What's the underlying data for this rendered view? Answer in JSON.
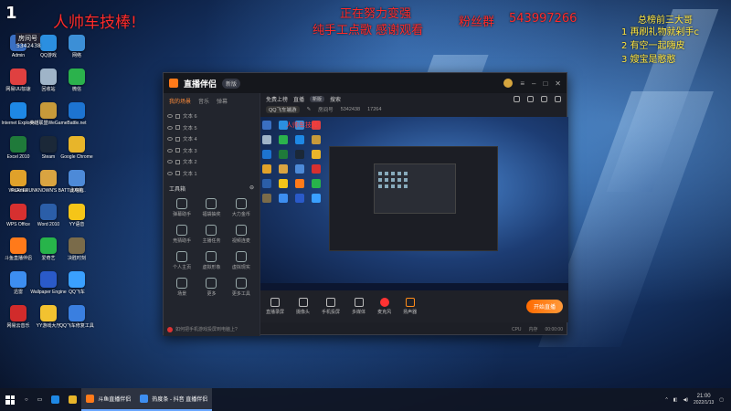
{
  "overlay": {
    "top_left_logo": "1",
    "title_red": "人帅车技棒!",
    "room_badge": "房间号",
    "room_number": "5342438",
    "center_line1": "正在努力变强",
    "center_line2": "纯手工点歌 感谢观看",
    "fan_group_label": "粉丝群",
    "fan_group_number": "543997266",
    "right_title": "总榜前三大哥",
    "right_list": [
      "1 再刷礼物就剁手c",
      "2 有空一起嗨皮",
      "3 嫂宝是憨憨"
    ]
  },
  "desktop_icons": [
    {
      "label": "Admin",
      "color": "#3a6fc2"
    },
    {
      "label": "QQ游戏",
      "color": "#2b8fe0"
    },
    {
      "label": "网络",
      "color": "#3c8fd6"
    },
    {
      "label": "网易UU加速",
      "color": "#e04040"
    },
    {
      "label": "回收站",
      "color": "#9fb4c8"
    },
    {
      "label": "微信",
      "color": "#2bb24c"
    },
    {
      "label": "Internet Explorer",
      "color": "#1e88e5"
    },
    {
      "label": "英雄联盟WeGame",
      "color": "#c79a3a"
    },
    {
      "label": "Battle.net",
      "color": "#1d74d1"
    },
    {
      "label": "Excel 2010",
      "color": "#1f7a3a"
    },
    {
      "label": "Steam",
      "color": "#1b2838"
    },
    {
      "label": "Google Chrome",
      "color": "#e8b52a"
    },
    {
      "label": "WeGame",
      "color": "#e0a12a"
    },
    {
      "label": "PLAYERUNKNOWN'S BATTLEGR...",
      "color": "#d9a441"
    },
    {
      "label": "此电脑",
      "color": "#4d8ad8"
    },
    {
      "label": "WPS Office",
      "color": "#d63030"
    },
    {
      "label": "Word 2010",
      "color": "#2b5ea8"
    },
    {
      "label": "YY语音",
      "color": "#f5c518"
    },
    {
      "label": "斗鱼直播伴侣",
      "color": "#ff7a1a"
    },
    {
      "label": "爱奇艺",
      "color": "#27b44a"
    },
    {
      "label": "决胜时刻",
      "color": "#7a6b4a"
    },
    {
      "label": "迅雷",
      "color": "#3d8ef0"
    },
    {
      "label": "Wallpaper Engine",
      "color": "#2a5ac9"
    },
    {
      "label": "QQ飞车",
      "color": "#3aa0ff"
    },
    {
      "label": "网易云音乐",
      "color": "#d12b2b"
    },
    {
      "label": "YY游戏大厅",
      "color": "#f2c230"
    },
    {
      "label": "QQ飞车修复工具",
      "color": "#3a7fe0"
    }
  ],
  "app": {
    "name": "直播伴侣",
    "version": "新版",
    "left_tabs": [
      "我的场景",
      "音乐",
      "弹幕"
    ],
    "scenes": [
      "文本 6",
      "文本 5",
      "文本 4",
      "文本 3",
      "文本 2",
      "文本 1"
    ],
    "tools_title": "工具箱",
    "tools": [
      "弹幕助手",
      "福袋抽奖",
      "大力金币",
      "竞猜助手",
      "主播任务",
      "视频连麦",
      "个人主页",
      "虚拟形象",
      "虚拟现实",
      "场景",
      "更多",
      "更多工具"
    ],
    "footer_tip": "如何把手机游戏投屏到电脑上?",
    "channel_tabs": [
      "免费上榜",
      "直播",
      "搜索"
    ],
    "channel_badge": "新版",
    "channel_tag": "QQ飞车端游",
    "channel_info": [
      "房间号",
      "5342438",
      "17264"
    ],
    "bottom_tools": [
      "直播录屏",
      "摄像头",
      "手机投屏",
      "多媒体",
      "麦克风",
      "扬声器"
    ],
    "go_live": "开始直播",
    "status": [
      "CPU",
      "内存",
      "00:00:00"
    ]
  },
  "taskbar": {
    "buttons": [
      {
        "label": "斗鱼直播伴侣",
        "color": "#ff7a1a"
      },
      {
        "label": "热度条 - 抖音 直播伴侣",
        "color": "#3d8ef0"
      }
    ],
    "time": "21:00",
    "date": "2022/1/13"
  }
}
